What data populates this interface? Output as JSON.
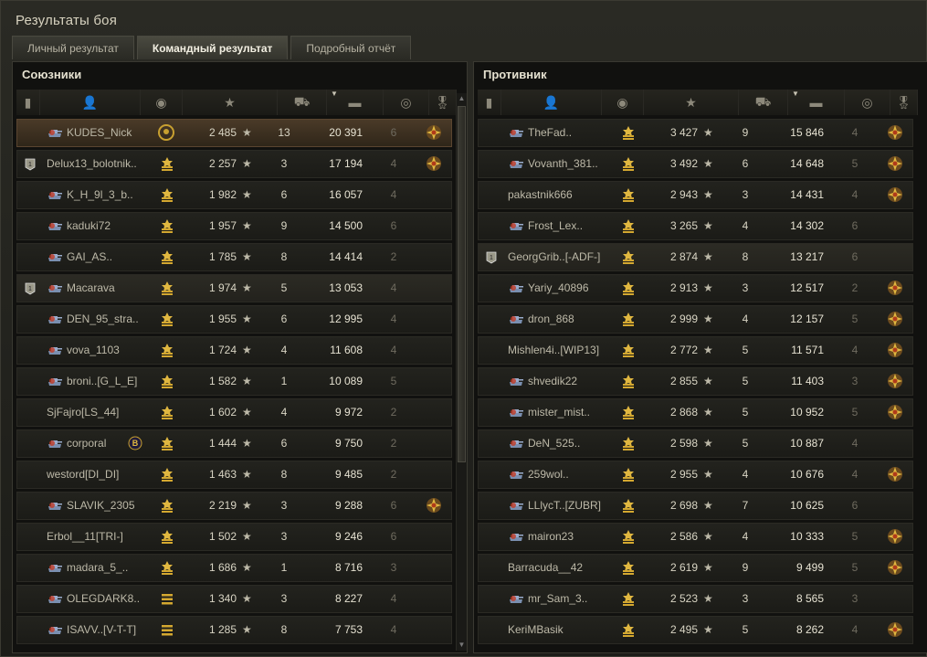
{
  "window": {
    "title": "Результаты боя"
  },
  "tabs": [
    {
      "label": "Личный результат",
      "active": false
    },
    {
      "label": "Командный результат",
      "active": true
    },
    {
      "label": "Подробный отчёт",
      "active": false
    }
  ],
  "columns": [
    "platoon",
    "player",
    "rank",
    "experience",
    "kills",
    "damage",
    "spotted",
    "medals"
  ],
  "colors": {
    "accent": "#c8a030",
    "highlight_row": "#4a3a28"
  },
  "allies": {
    "title": "Союзники",
    "rows": [
      {
        "name": "KUDES_Nick",
        "xp": "2 485",
        "kills": "13",
        "dmg": "20 391",
        "spot": "6",
        "rank": "wreath",
        "tank": "tank-icon",
        "medal": "2",
        "platoon": "",
        "highlight": true
      },
      {
        "name": "Delux13_bolotnik..",
        "xp": "2 257",
        "kills": "3",
        "dmg": "17 194",
        "spot": "4",
        "rank": "chevrons",
        "tank": "",
        "medal": "medal",
        "platoon": "platoon"
      },
      {
        "name": "K_H_9l_3_b..",
        "xp": "1 982",
        "kills": "6",
        "dmg": "16 057",
        "spot": "4",
        "rank": "chevrons",
        "tank": "tank-icon"
      },
      {
        "name": "kaduki72",
        "xp": "1 957",
        "kills": "9",
        "dmg": "14 500",
        "spot": "6",
        "rank": "chevrons",
        "tank": "tank-icon"
      },
      {
        "name": "GAI_AS..",
        "xp": "1 785",
        "kills": "8",
        "dmg": "14 414",
        "spot": "2",
        "rank": "chevrons",
        "tank": "tank-icon"
      },
      {
        "name": "Macarava",
        "xp": "1 974",
        "kills": "5",
        "dmg": "13 053",
        "spot": "4",
        "rank": "chevrons",
        "tank": "tank-icon",
        "platoon": "platoon",
        "squad": true
      },
      {
        "name": "DEN_95_stra..",
        "xp": "1 955",
        "kills": "6",
        "dmg": "12 995",
        "spot": "4",
        "rank": "chevrons",
        "tank": "tank-icon"
      },
      {
        "name": "vova_1103",
        "xp": "1 724",
        "kills": "4",
        "dmg": "11 608",
        "spot": "4",
        "rank": "chevrons",
        "tank": "tank-icon"
      },
      {
        "name": "broni..[G_L_E]",
        "xp": "1 582",
        "kills": "1",
        "dmg": "10 089",
        "spot": "5",
        "rank": "chevrons",
        "tank": "tank-icon"
      },
      {
        "name": "SjFajro[LS_44]",
        "xp": "1 602",
        "kills": "4",
        "dmg": "9 972",
        "spot": "2",
        "rank": "chevrons",
        "tank": ""
      },
      {
        "name": "corporal",
        "xp": "1 444",
        "kills": "6",
        "dmg": "9 750",
        "spot": "2",
        "rank": "chevrons",
        "tank": "tank-icon",
        "clan": "clan"
      },
      {
        "name": "westord[DI_DI]",
        "xp": "1 463",
        "kills": "8",
        "dmg": "9 485",
        "spot": "2",
        "rank": "chevrons",
        "tank": ""
      },
      {
        "name": "SLAVIK_2305",
        "xp": "2 219",
        "kills": "3",
        "dmg": "9 288",
        "spot": "6",
        "rank": "chevrons",
        "tank": "tank-icon",
        "medal": "medal"
      },
      {
        "name": "Erbol__11[TRI-]",
        "xp": "1 502",
        "kills": "3",
        "dmg": "9 246",
        "spot": "6",
        "rank": "chevrons",
        "tank": ""
      },
      {
        "name": "madara_5_..",
        "xp": "1 686",
        "kills": "1",
        "dmg": "8 716",
        "spot": "3",
        "rank": "chevrons",
        "tank": "tank-icon"
      },
      {
        "name": "OLEGDARK8..",
        "xp": "1 340",
        "kills": "3",
        "dmg": "8 227",
        "spot": "4",
        "rank": "bars",
        "tank": "tank-icon"
      },
      {
        "name": "ISAVV..[V-T-T]",
        "xp": "1 285",
        "kills": "8",
        "dmg": "7 753",
        "spot": "4",
        "rank": "bars",
        "tank": "tank-icon"
      }
    ]
  },
  "enemies": {
    "title": "Противник",
    "rows": [
      {
        "name": "TheFad..",
        "xp": "3 427",
        "kills": "9",
        "dmg": "15 846",
        "spot": "4",
        "rank": "chevrons",
        "tank": "tank-icon",
        "medal": "medal"
      },
      {
        "name": "Vovanth_381..",
        "xp": "3 492",
        "kills": "6",
        "dmg": "14 648",
        "spot": "5",
        "rank": "chevrons",
        "tank": "tank-icon",
        "medal": "medal"
      },
      {
        "name": "pakastnik666",
        "xp": "2 943",
        "kills": "3",
        "dmg": "14 431",
        "spot": "4",
        "rank": "chevrons",
        "tank": "",
        "medal": "medal"
      },
      {
        "name": "Frost_Lex..",
        "xp": "3 265",
        "kills": "4",
        "dmg": "14 302",
        "spot": "6",
        "rank": "chevrons",
        "tank": "tank-icon"
      },
      {
        "name": "GeorgGrib..[-ADF-]",
        "xp": "2 874",
        "kills": "8",
        "dmg": "13 217",
        "spot": "6",
        "rank": "chevrons",
        "tank": "",
        "platoon": "platoon",
        "squad": true
      },
      {
        "name": "Yariy_40896",
        "xp": "2 913",
        "kills": "3",
        "dmg": "12 517",
        "spot": "2",
        "rank": "chevrons",
        "tank": "tank-icon",
        "medal": "medal"
      },
      {
        "name": "dron_868",
        "xp": "2 999",
        "kills": "4",
        "dmg": "12 157",
        "spot": "5",
        "rank": "chevrons",
        "tank": "tank-icon",
        "medal": "medal"
      },
      {
        "name": "Mishlen4i..[WIP13]",
        "xp": "2 772",
        "kills": "5",
        "dmg": "11 571",
        "spot": "4",
        "rank": "chevrons",
        "tank": "",
        "medal": "medal"
      },
      {
        "name": "shvedik22",
        "xp": "2 855",
        "kills": "5",
        "dmg": "11 403",
        "spot": "3",
        "rank": "chevrons",
        "tank": "tank-icon",
        "medal": "medal"
      },
      {
        "name": "mister_mist..",
        "xp": "2 868",
        "kills": "5",
        "dmg": "10 952",
        "spot": "5",
        "rank": "chevrons",
        "tank": "tank-icon",
        "medal": "medal"
      },
      {
        "name": "DeN_525..",
        "xp": "2 598",
        "kills": "5",
        "dmg": "10 887",
        "spot": "4",
        "rank": "chevrons",
        "tank": "tank-icon"
      },
      {
        "name": "259wol..",
        "xp": "2 955",
        "kills": "4",
        "dmg": "10 676",
        "spot": "4",
        "rank": "chevrons",
        "tank": "tank-icon",
        "medal": "medal"
      },
      {
        "name": "LLlycT..[ZUBR]",
        "xp": "2 698",
        "kills": "7",
        "dmg": "10 625",
        "spot": "6",
        "rank": "chevrons",
        "tank": "tank-icon"
      },
      {
        "name": "mairon23",
        "xp": "2 586",
        "kills": "4",
        "dmg": "10 333",
        "spot": "5",
        "rank": "chevrons",
        "tank": "tank-icon",
        "medal": "medal"
      },
      {
        "name": "Barracuda__42",
        "xp": "2 619",
        "kills": "9",
        "dmg": "9 499",
        "spot": "5",
        "rank": "chevrons",
        "tank": "",
        "medal": "medal"
      },
      {
        "name": "mr_Sam_3..",
        "xp": "2 523",
        "kills": "3",
        "dmg": "8 565",
        "spot": "3",
        "rank": "chevrons",
        "tank": "tank-icon"
      },
      {
        "name": "KeriMBasik",
        "xp": "2 495",
        "kills": "5",
        "dmg": "8 262",
        "spot": "4",
        "rank": "chevrons",
        "tank": "",
        "medal": "medal"
      }
    ]
  }
}
